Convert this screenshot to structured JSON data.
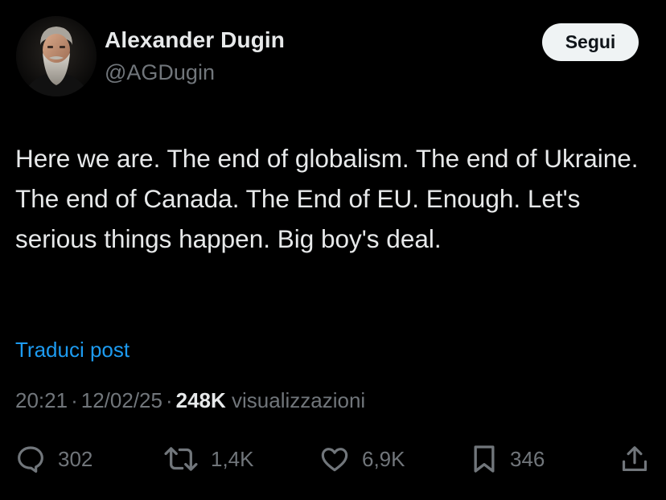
{
  "author": {
    "name": "Alexander Dugin",
    "handle": "@AGDugin"
  },
  "follow_button": {
    "label": "Segui"
  },
  "post": {
    "text": "Here we are. The end of globalism. The end of Ukraine. The end of Canada. The End of EU. Enough. Let's serious things happen. Big boy's deal.",
    "translate_label": "Traduci post"
  },
  "meta": {
    "time": "20:21",
    "separator": "·",
    "date": "12/02/25",
    "views_count": "248K",
    "views_label": "visualizzazioni"
  },
  "actions": {
    "replies": {
      "icon": "reply-icon",
      "count": "302"
    },
    "reposts": {
      "icon": "repost-icon",
      "count": "1,4K"
    },
    "likes": {
      "icon": "heart-icon",
      "count": "6,9K"
    },
    "bookmarks": {
      "icon": "bookmark-icon",
      "count": "346"
    },
    "share": {
      "icon": "share-icon"
    }
  },
  "colors": {
    "background": "#000000",
    "text_primary": "#e7e9ea",
    "text_secondary": "#71767b",
    "link": "#1d9bf0",
    "button_bg": "#eff3f4",
    "button_text": "#0f1419"
  }
}
